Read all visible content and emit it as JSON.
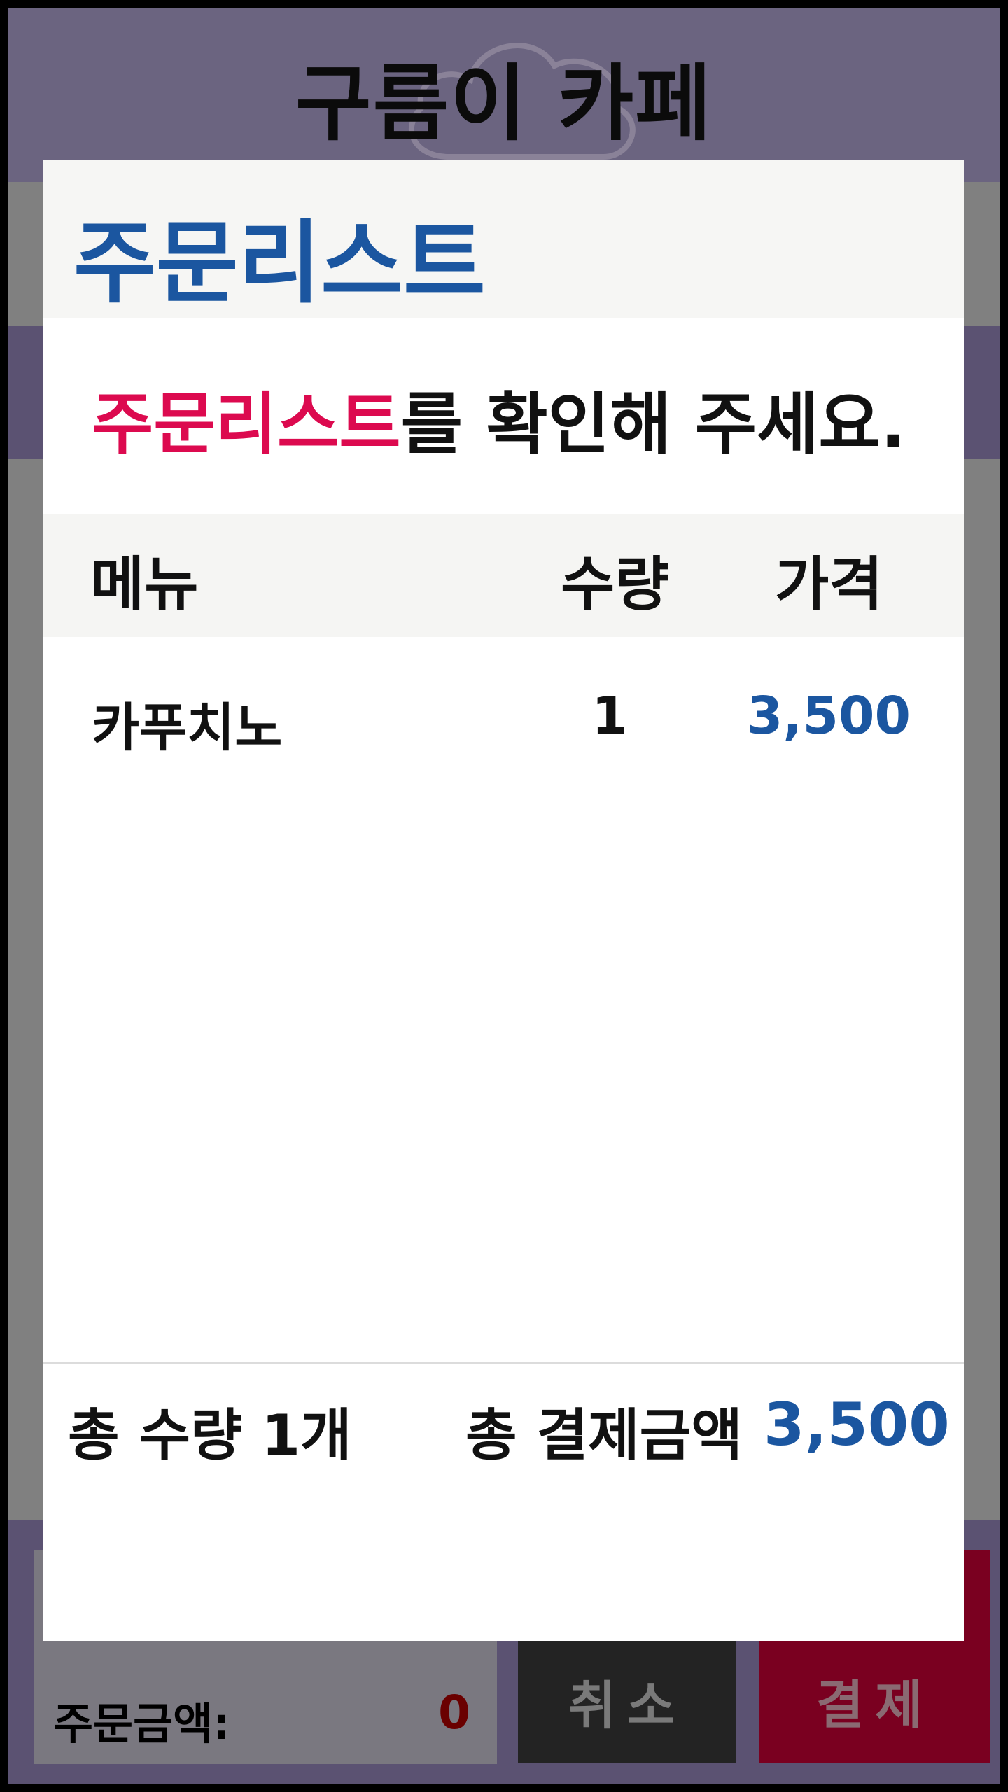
{
  "app": {
    "title": "구름이 카페"
  },
  "modal": {
    "title": "주문리스트",
    "instruction_highlight": "주문리스트",
    "instruction_rest": "를 확인해 주세요.",
    "columns": {
      "menu": "메뉴",
      "qty": "수량",
      "price": "가격"
    },
    "items": [
      {
        "name": "카푸치노",
        "qty": "1",
        "price": "3,500"
      }
    ],
    "summary": {
      "total_qty": "총 수량 1개",
      "total_amount_label": "총 결제금액",
      "total_amount_value": "3,500"
    }
  },
  "footer": {
    "amount_label": "주문금액:",
    "amount_value": "0",
    "cancel_label": "취소",
    "pay_label": "결제"
  },
  "colors": {
    "title_blue": "#1b56a0",
    "highlight_pink": "#dc0a4f",
    "pay_red": "#7a0020",
    "overlay_purple": "#5b5272"
  }
}
